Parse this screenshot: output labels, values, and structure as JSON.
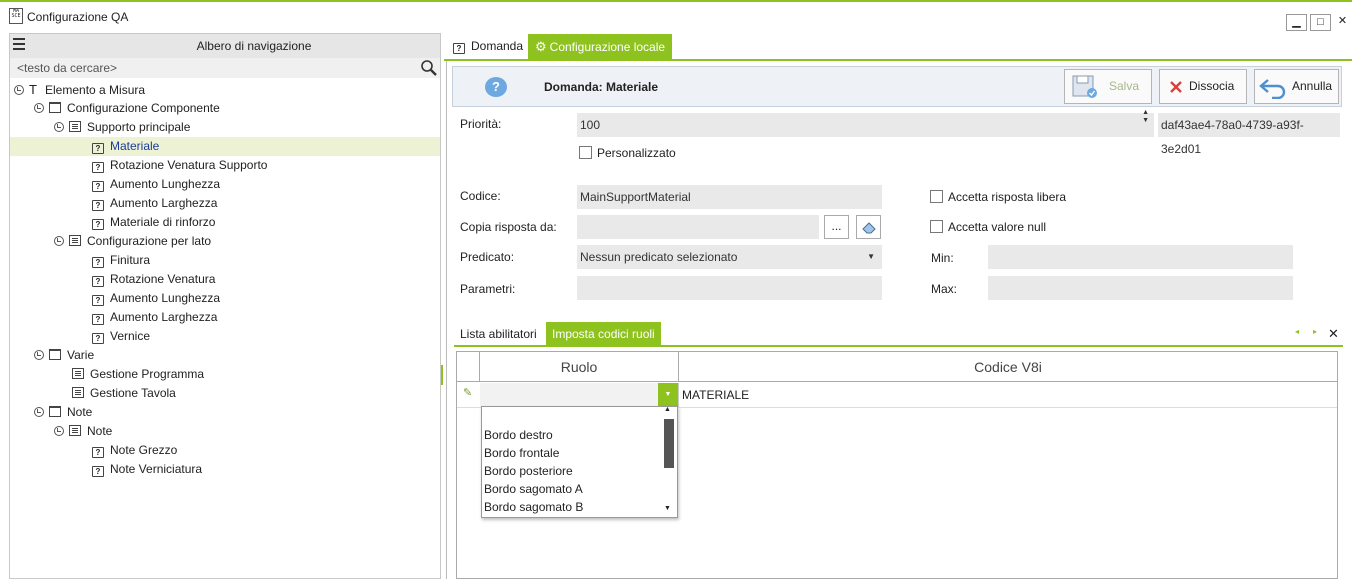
{
  "window": {
    "title": "Configurazione QA",
    "logo_text": "MA SCE",
    "controls": {
      "minimize": "▁",
      "maximize": "□",
      "close": "✕"
    }
  },
  "navigation": {
    "title": "Albero di navigazione",
    "search_placeholder": "<testo da cercare>",
    "tree": [
      {
        "label": "Elemento a Misura",
        "icon": "text-type-icon",
        "expander": true,
        "level": 0
      },
      {
        "label": "Configurazione Componente",
        "icon": "folder-icon",
        "expander": true,
        "level": 1
      },
      {
        "label": "Supporto principale",
        "icon": "list-icon",
        "expander": true,
        "level": 2
      },
      {
        "label": "Materiale",
        "icon": "question-icon",
        "expander": false,
        "level": 3,
        "selected": true
      },
      {
        "label": "Rotazione Venatura Supporto",
        "icon": "question-icon",
        "expander": false,
        "level": 3
      },
      {
        "label": "Aumento Lunghezza",
        "icon": "question-icon",
        "expander": false,
        "level": 3
      },
      {
        "label": "Aumento Larghezza",
        "icon": "question-icon",
        "expander": false,
        "level": 3
      },
      {
        "label": "Materiale di rinforzo",
        "icon": "question-icon",
        "expander": false,
        "level": 3
      },
      {
        "label": "Configurazione per lato",
        "icon": "list-icon",
        "expander": true,
        "level": 2
      },
      {
        "label": "Finitura",
        "icon": "question-icon",
        "expander": false,
        "level": 3
      },
      {
        "label": "Rotazione Venatura",
        "icon": "question-icon",
        "expander": false,
        "level": 3
      },
      {
        "label": "Aumento Lunghezza",
        "icon": "question-icon",
        "expander": false,
        "level": 3
      },
      {
        "label": "Aumento Larghezza",
        "icon": "question-icon",
        "expander": false,
        "level": 3
      },
      {
        "label": "Vernice",
        "icon": "question-icon",
        "expander": false,
        "level": 3
      },
      {
        "label": "Varie",
        "icon": "folder-icon",
        "expander": true,
        "level": 1
      },
      {
        "label": "Gestione Programma",
        "icon": "list-icon",
        "expander": false,
        "level": 2
      },
      {
        "label": "Gestione Tavola",
        "icon": "list-icon",
        "expander": false,
        "level": 2
      },
      {
        "label": "Note",
        "icon": "folder-icon",
        "expander": true,
        "level": 1
      },
      {
        "label": "Note",
        "icon": "list-icon",
        "expander": true,
        "level": 2
      },
      {
        "label": "Note Grezzo",
        "icon": "question-icon",
        "expander": false,
        "level": 3
      },
      {
        "label": "Note Verniciatura",
        "icon": "question-icon",
        "expander": false,
        "level": 3
      }
    ]
  },
  "tabs": {
    "domanda": "Domanda",
    "config_locale": "Configurazione locale"
  },
  "header": {
    "title": "Domanda: Materiale",
    "save": "Salva",
    "dissocia": "Dissocia",
    "annulla": "Annulla"
  },
  "form": {
    "priorita_label": "Priorità:",
    "priorita_value": "100",
    "guid": "daf43ae4-78a0-4739-a93f-3e2d01",
    "personalizzato": "Personalizzato",
    "codice_label": "Codice:",
    "codice_value": "MainSupportMaterial",
    "copia_label": "Copia risposta da:",
    "copia_value": "",
    "browse_label": "...",
    "predicato_label": "Predicato:",
    "predicato_value": "Nessun predicato selezionato",
    "parametri_label": "Parametri:",
    "accetta_libera": "Accetta risposta libera",
    "accetta_null": "Accetta valore null",
    "min_label": "Min:",
    "max_label": "Max:"
  },
  "bottom_tabs": {
    "lista": "Lista abilitatori",
    "imposta": "Imposta codici ruoli"
  },
  "grid": {
    "columns": [
      "Ruolo",
      "Codice V8i"
    ],
    "row": {
      "ruolo": "",
      "codice": "MATERIALE"
    }
  },
  "dropdown_options": [
    "Bordo destro",
    "Bordo frontale",
    "Bordo posteriore",
    "Bordo sagomato A",
    "Bordo sagomato B"
  ],
  "colors": {
    "accent": "#8dc21f",
    "selection": "#eef2d4"
  }
}
